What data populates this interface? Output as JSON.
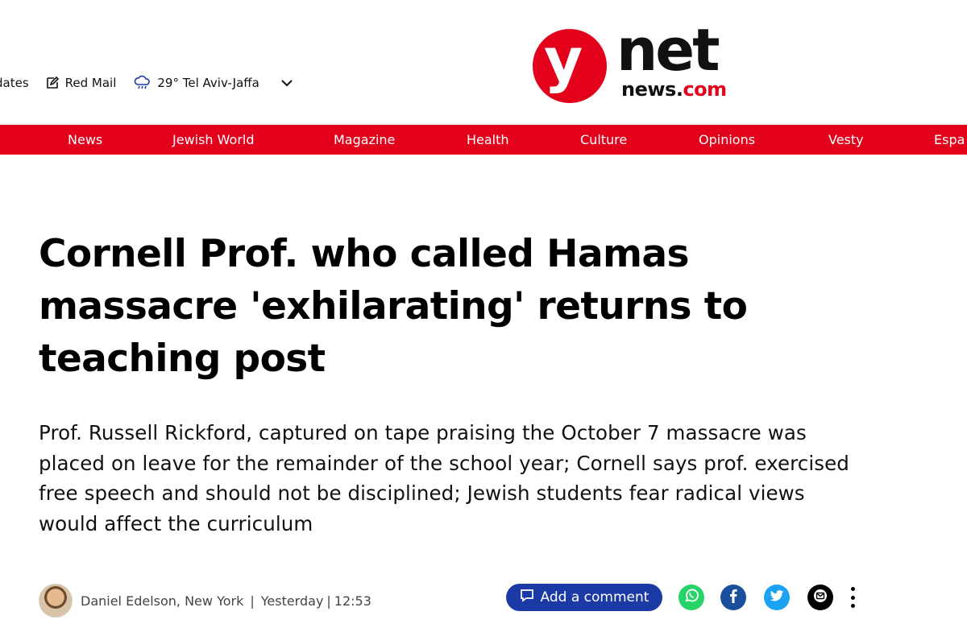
{
  "topbar": {
    "updates_label": "dates",
    "redmail_label": "Red Mail",
    "weather_label": "29° Tel Aviv-Jaffa"
  },
  "logo": {
    "y": "y",
    "net": "net",
    "news_part1": "news.",
    "news_part2": "com"
  },
  "nav": [
    {
      "label": "News"
    },
    {
      "label": "Jewish World"
    },
    {
      "label": "Magazine"
    },
    {
      "label": "Health"
    },
    {
      "label": "Culture"
    },
    {
      "label": "Opinions"
    },
    {
      "label": "Vesty"
    },
    {
      "label": "Espa"
    }
  ],
  "article": {
    "headline": "Cornell Prof. who called Hamas massacre 'exhilarating' returns to teaching post",
    "subtitle": "Prof. Russell Rickford, captured on tape praising the October 7 massacre was placed on leave for the remainder of the school year; Cornell says prof. exercised free speech and should not be disciplined; Jewish students fear radical views would affect the curriculum",
    "byline": {
      "author": "Daniel Edelson, New York",
      "separator": "|",
      "date": "Yesterday",
      "time": "12:53"
    }
  },
  "actions": {
    "comment_label": "Add a comment"
  },
  "colors": {
    "brand_red": "#e3001b",
    "comment_blue": "#1c3aa6",
    "whatsapp": "#25d366",
    "facebook": "#1b4f9c",
    "twitter": "#1da1f2"
  }
}
